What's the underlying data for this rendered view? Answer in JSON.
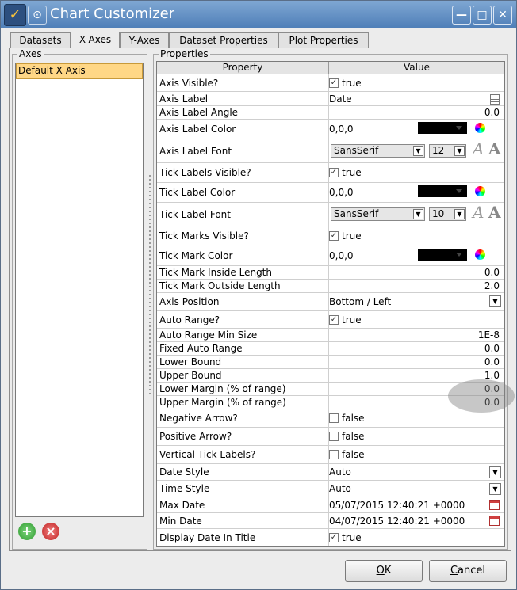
{
  "window": {
    "title": "Chart Customizer"
  },
  "tabs": [
    {
      "label": "Datasets"
    },
    {
      "label": "X-Axes"
    },
    {
      "label": "Y-Axes"
    },
    {
      "label": "Dataset Properties"
    },
    {
      "label": "Plot Properties"
    }
  ],
  "axes_panel": {
    "title": "Axes",
    "items": [
      {
        "label": "Default X Axis"
      }
    ]
  },
  "properties_panel": {
    "title": "Properties",
    "header": {
      "property": "Property",
      "value": "Value"
    },
    "rows": [
      {
        "property": "Axis Visible?",
        "value": "true",
        "checked": true
      },
      {
        "property": "Axis Label",
        "value": "Date"
      },
      {
        "property": "Axis Label Angle",
        "value": "0.0"
      },
      {
        "property": "Axis Label Color",
        "value": "0,0,0"
      },
      {
        "property": "Axis Label Font",
        "font": "SansSerif",
        "size": "12",
        "sample": "A"
      },
      {
        "property": "Tick Labels Visible?",
        "value": "true",
        "checked": true
      },
      {
        "property": "Tick Label Color",
        "value": "0,0,0"
      },
      {
        "property": "Tick Label Font",
        "font": "SansSerif",
        "size": "10",
        "sample": "A"
      },
      {
        "property": "Tick Marks Visible?",
        "value": "true",
        "checked": true
      },
      {
        "property": "Tick Mark Color",
        "value": "0,0,0"
      },
      {
        "property": "Tick Mark Inside Length",
        "value": "0.0"
      },
      {
        "property": "Tick Mark Outside Length",
        "value": "2.0"
      },
      {
        "property": "Axis Position",
        "value": "Bottom / Left"
      },
      {
        "property": "Auto Range?",
        "value": "true",
        "checked": true
      },
      {
        "property": "Auto Range Min Size",
        "value": "1E-8"
      },
      {
        "property": "Fixed Auto Range",
        "value": "0.0"
      },
      {
        "property": "Lower Bound",
        "value": "0.0"
      },
      {
        "property": "Upper Bound",
        "value": "1.0"
      },
      {
        "property": "Lower Margin (% of range)",
        "value": "0.0"
      },
      {
        "property": "Upper Margin (% of range)",
        "value": "0.0"
      },
      {
        "property": "Negative Arrow?",
        "value": "false",
        "checked": false
      },
      {
        "property": "Positive Arrow?",
        "value": "false",
        "checked": false
      },
      {
        "property": "Vertical Tick Labels?",
        "value": "false",
        "checked": false
      },
      {
        "property": "Date Style",
        "value": "Auto"
      },
      {
        "property": "Time Style",
        "value": "Auto"
      },
      {
        "property": "Max Date",
        "value": "05/07/2015 12:40:21 +0000"
      },
      {
        "property": "Min Date",
        "value": "04/07/2015 12:40:21 +0000"
      },
      {
        "property": "Display Date In Title",
        "value": "true",
        "checked": true
      }
    ]
  },
  "buttons": {
    "ok_key": "O",
    "ok_rest": "K",
    "cancel_key": "C",
    "cancel_rest": "ancel"
  },
  "colors": {
    "titlebar": "#5b89c0",
    "selection": "#ffd786",
    "swatch": "#000000"
  }
}
